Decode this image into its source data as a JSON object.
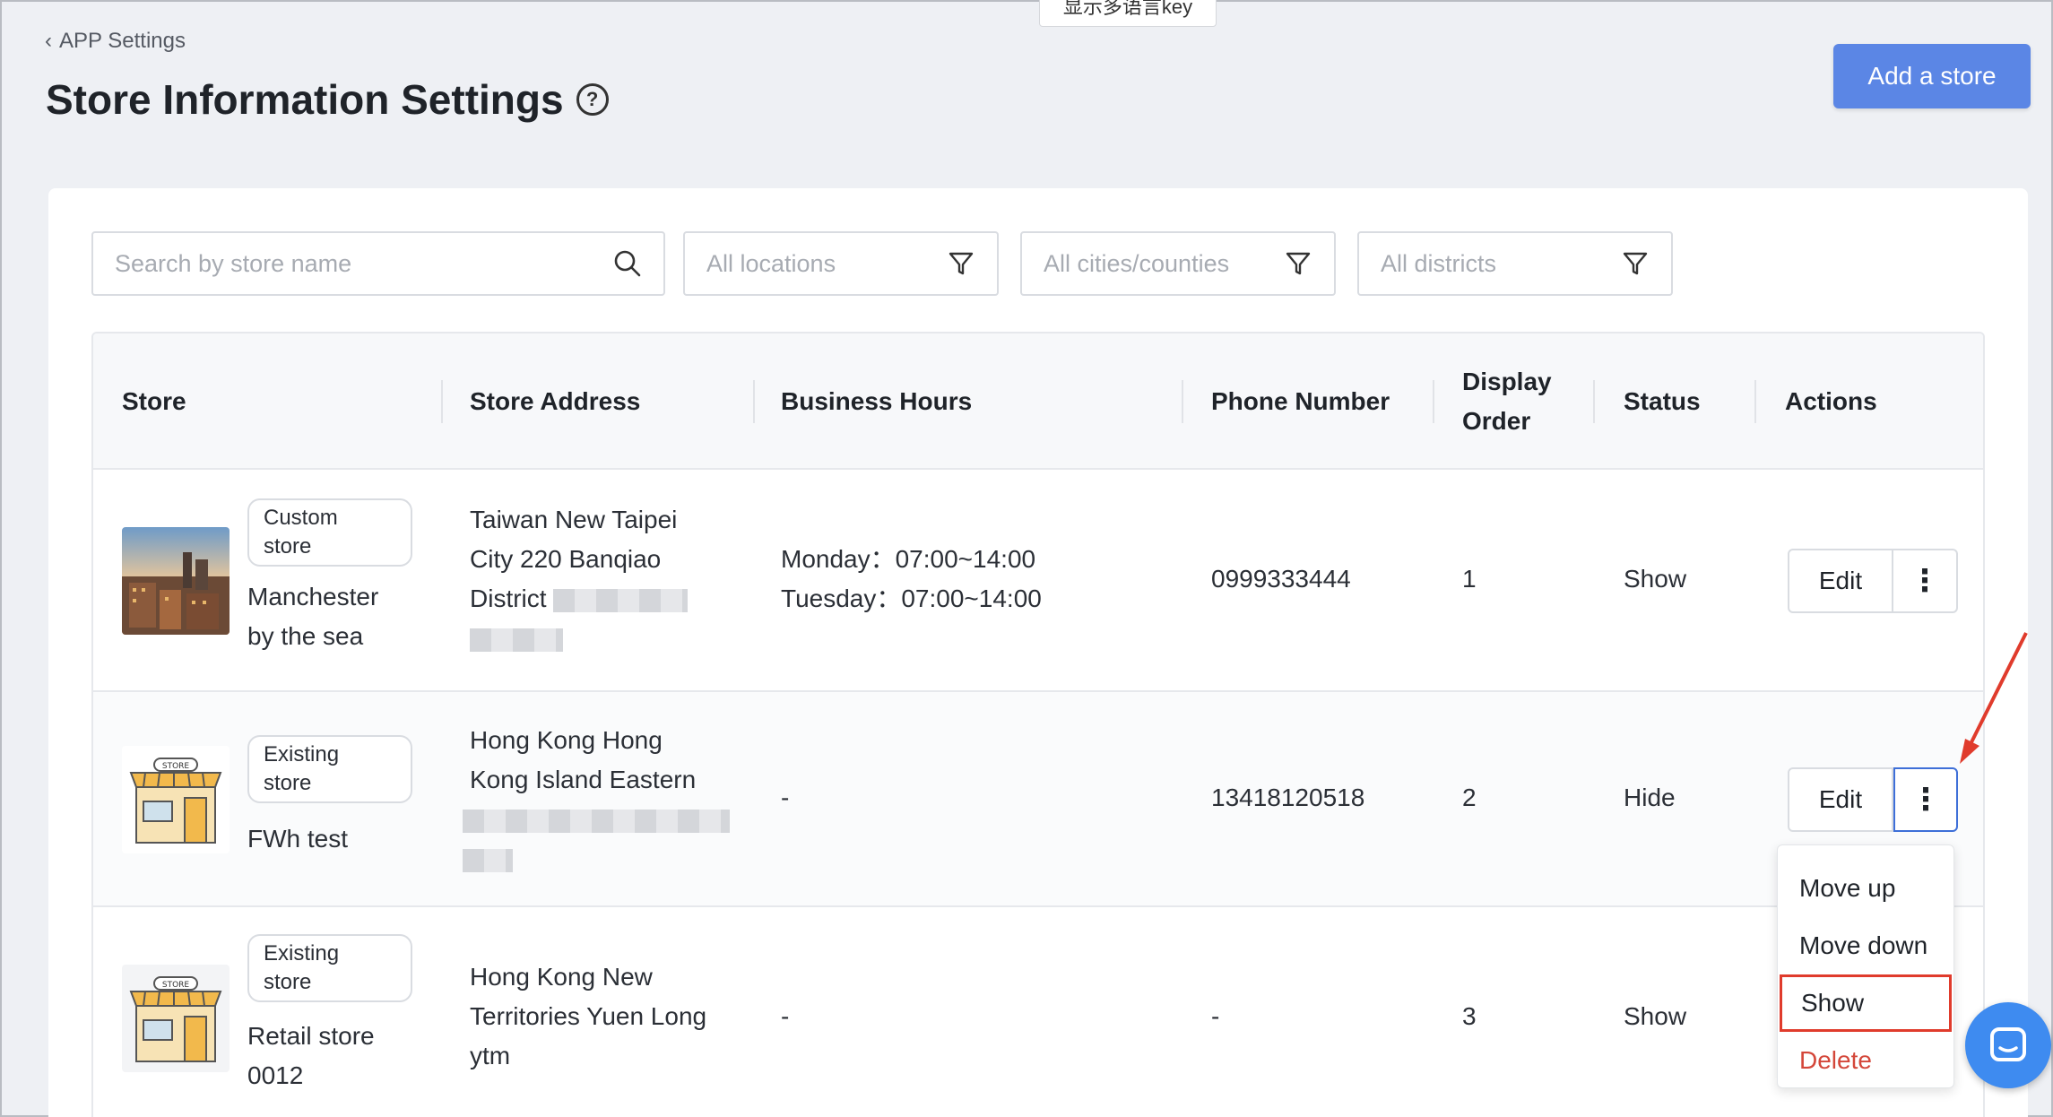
{
  "top_tooltip": "显示多语言key",
  "breadcrumb": {
    "back_label": "APP Settings"
  },
  "page": {
    "title": "Store Information Settings",
    "add_button": "Add a store"
  },
  "filters": {
    "search_placeholder": "Search by store name",
    "locations": "All locations",
    "cities": "All cities/counties",
    "districts": "All districts"
  },
  "table": {
    "headers": {
      "store": "Store",
      "address": "Store Address",
      "hours": "Business Hours",
      "phone": "Phone Number",
      "order_line1": "Display",
      "order_line2": "Order",
      "status": "Status",
      "actions": "Actions"
    },
    "rows": [
      {
        "tag_line1": "Custom",
        "tag_line2": "store",
        "name_line1": "Manchester",
        "name_line2": "by the sea",
        "address_line1": "Taiwan New Taipei",
        "address_line2": "City 220 Banqiao",
        "address_line3": "District",
        "hours_line1": "Monday：07:00~14:00",
        "hours_line2": "Tuesday：07:00~14:00",
        "phone": "0999333444",
        "order": "1",
        "status": "Show",
        "edit": "Edit"
      },
      {
        "tag_line1": "Existing",
        "tag_line2": "store",
        "name_line1": "FWh test",
        "address_line1": "Hong Kong Hong",
        "address_line2": "Kong Island Eastern",
        "hours": "-",
        "phone": "13418120518",
        "order": "2",
        "status": "Hide",
        "edit": "Edit"
      },
      {
        "tag_line1": "Existing",
        "tag_line2": "store",
        "name_line1": "Retail store",
        "name_line2": "0012",
        "address_line1": "Hong Kong New",
        "address_line2": "Territories Yuen Long",
        "address_line3": "ytm",
        "hours": "-",
        "phone": "-",
        "order": "3",
        "status": "Show"
      }
    ]
  },
  "dropdown": {
    "move_up": "Move up",
    "move_down": "Move down",
    "show": "Show",
    "delete": "Delete"
  },
  "store_icon_text": "STORE",
  "colors": {
    "primary": "#5b86e5",
    "danger": "#d4473a",
    "highlight": "#e03b2c",
    "chat": "#3e8bf0"
  }
}
